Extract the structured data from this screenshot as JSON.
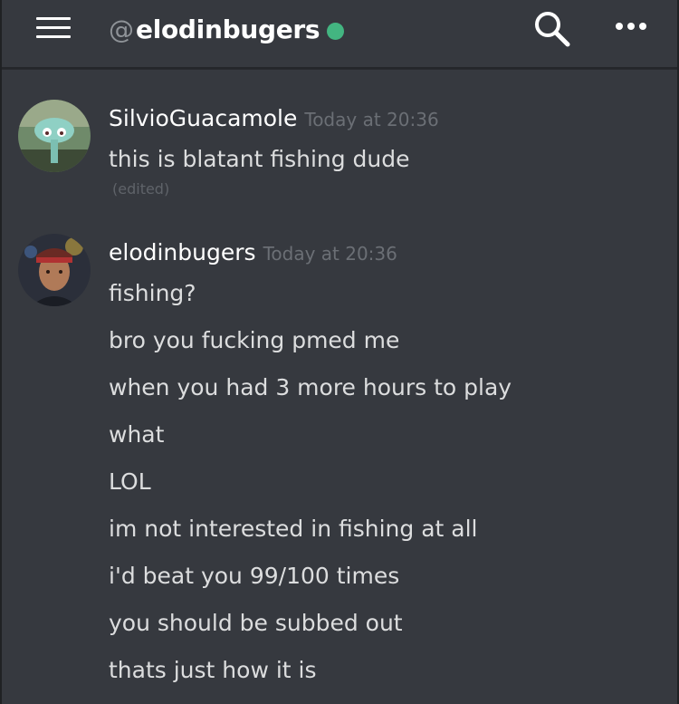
{
  "header": {
    "at_symbol": "@",
    "channel_name": "elodinbugers",
    "status_color": "#43b581"
  },
  "icons": {
    "menu": "hamburger-menu-icon",
    "search": "search-icon",
    "more": "more-options-icon"
  },
  "colors": {
    "background": "#36393f",
    "username": "#ffffff",
    "message_text": "#dcddde",
    "timestamp": "#6b6f75",
    "online": "#43b581"
  },
  "messages": [
    {
      "author": "SilvioGuacamole",
      "timestamp": "Today at 20:36",
      "lines": [
        "this is blatant fishing dude"
      ],
      "edited_label": "(edited)"
    },
    {
      "author": "elodinbugers",
      "timestamp": "Today at 20:36",
      "lines": [
        "fishing?",
        "bro you fucking pmed me",
        "when you had 3 more hours to play",
        "what",
        "LOL",
        "im not interested in fishing at all",
        "i'd beat you 99/100 times",
        "you should be subbed out",
        "thats just how it is"
      ]
    }
  ]
}
